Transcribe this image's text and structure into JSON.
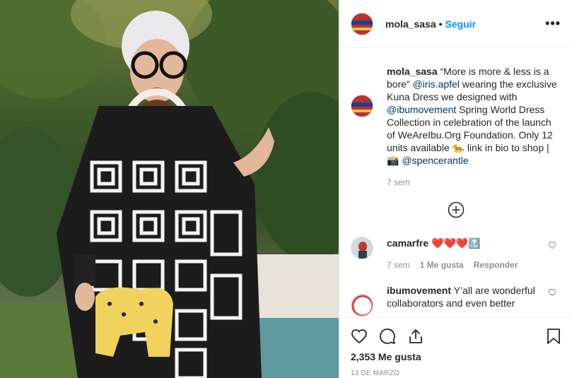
{
  "header": {
    "username": "mola_sasa",
    "separator": "•",
    "follow_label": "Seguir",
    "more_label": "•••"
  },
  "caption": {
    "username": "mola_sasa",
    "part1": " “More is more & less is a bore” ",
    "mention1": "@iris.apfel",
    "part2": " wearing the exclusive Kuna Dress we designed with ",
    "mention2": "@ibumovement",
    "part3": " Spring World Dress Collection in celebration of the launch of WeAreIbu.Org Foundation. Only 12 units available 🐆 link in bio to shop | 📸 ",
    "mention3": "@spencerantle",
    "time": "7 sem"
  },
  "comments": [
    {
      "username": "camarfre",
      "text": " ❤️❤️❤️🔝",
      "time": "7 sem",
      "likes": "1 Me gusta",
      "reply": "Responder"
    },
    {
      "username": "ibumovement",
      "text": " Y’all are wonderful collaborators and even better"
    }
  ],
  "footer": {
    "likes": "2,353 Me gusta",
    "date": "13 DE MARZO"
  },
  "colors": {
    "accent": "#0095f6",
    "mention": "#00376b",
    "muted": "#8e8e8e"
  },
  "icons": {
    "like": "heart-icon",
    "comment": "comment-bubble-icon",
    "share": "share-icon",
    "save": "bookmark-icon",
    "add": "plus-circle-icon"
  }
}
